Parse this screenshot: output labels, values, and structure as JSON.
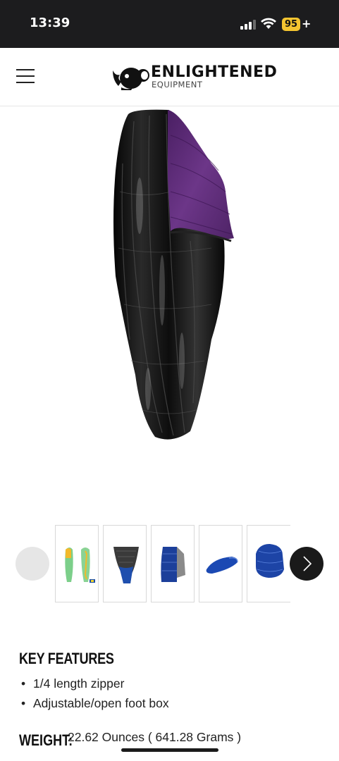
{
  "status_bar": {
    "time": "13:39",
    "battery_level": "95",
    "battery_suffix": "+",
    "signal_icon": "cellular-signal-icon",
    "wifi_icon": "wifi-icon"
  },
  "header": {
    "menu_icon": "hamburger-menu-icon",
    "logo_text": "ENLIGHTENED",
    "logo_subtext": "EQUIPMENT"
  },
  "gallery": {
    "prev_icon": "chevron-left-icon",
    "next_icon": "chevron-right-icon",
    "thumbnail_count": 5
  },
  "features": {
    "title": "KEY FEATURES",
    "items": [
      "1/4 length zipper",
      "Adjustable/open foot box"
    ]
  },
  "weight": {
    "label": "WEIGHT:",
    "value": "22.62 Ounces ( 641.28 Grams )"
  },
  "colors": {
    "shell": "#111111",
    "lining": "#5b2a72",
    "battery": "#f4c430",
    "status_bar_bg": "#1c1c1e"
  }
}
